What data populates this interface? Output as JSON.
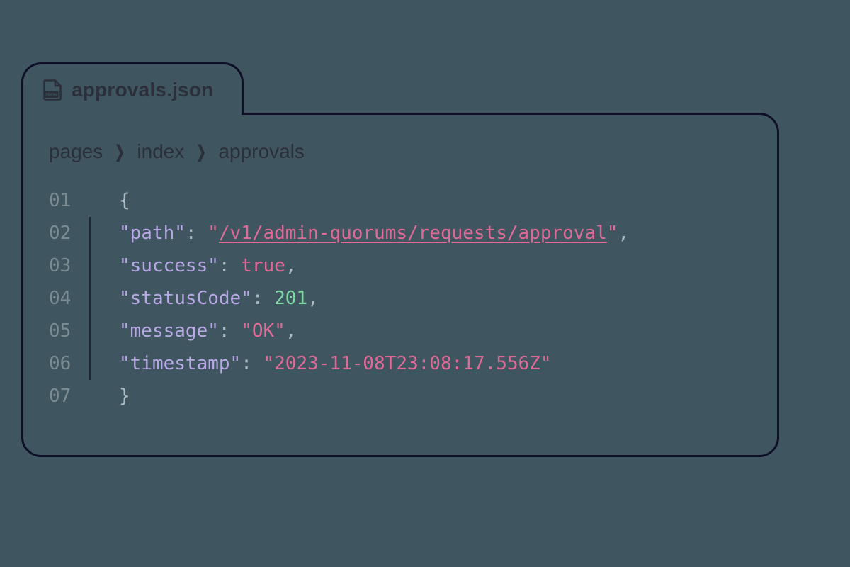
{
  "tab": {
    "filename": "approvals.json",
    "icon": "json-file-icon"
  },
  "breadcrumb": [
    "pages",
    "index",
    "approvals"
  ],
  "code": {
    "lines": [
      {
        "num": "01",
        "open": true,
        "tokens": [
          {
            "cls": "brace",
            "t": "{"
          }
        ]
      },
      {
        "num": "02",
        "open": false,
        "tokens": [
          {
            "cls": "k",
            "t": "\"path\""
          },
          {
            "cls": "p",
            "t": ": "
          },
          {
            "cls": "s",
            "t": "\""
          },
          {
            "cls": "s link",
            "t": "/v1/admin-quorums/requests/approval"
          },
          {
            "cls": "s",
            "t": "\""
          },
          {
            "cls": "p",
            "t": ","
          }
        ]
      },
      {
        "num": "03",
        "open": false,
        "tokens": [
          {
            "cls": "k",
            "t": "\"success\""
          },
          {
            "cls": "p",
            "t": ": "
          },
          {
            "cls": "b",
            "t": "true"
          },
          {
            "cls": "p",
            "t": ","
          }
        ]
      },
      {
        "num": "04",
        "open": false,
        "tokens": [
          {
            "cls": "k",
            "t": "\"statusCode\""
          },
          {
            "cls": "p",
            "t": ": "
          },
          {
            "cls": "n",
            "t": "201"
          },
          {
            "cls": "p",
            "t": ","
          }
        ]
      },
      {
        "num": "05",
        "open": false,
        "tokens": [
          {
            "cls": "k",
            "t": "\"message\""
          },
          {
            "cls": "p",
            "t": ": "
          },
          {
            "cls": "s",
            "t": "\"OK\""
          },
          {
            "cls": "p",
            "t": ","
          }
        ]
      },
      {
        "num": "06",
        "open": false,
        "tokens": [
          {
            "cls": "k",
            "t": "\"timestamp\""
          },
          {
            "cls": "p",
            "t": ": "
          },
          {
            "cls": "s",
            "t": "\"2023-11-08T23:08:17.556Z\""
          }
        ]
      },
      {
        "num": "07",
        "open": true,
        "tokens": [
          {
            "cls": "brace",
            "t": "}"
          }
        ]
      }
    ]
  }
}
